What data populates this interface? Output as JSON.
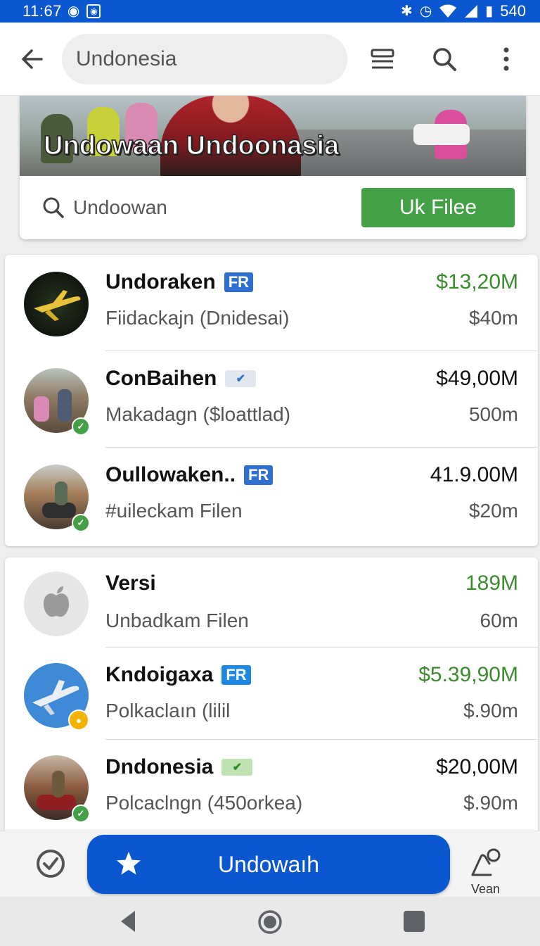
{
  "status_bar": {
    "time": "11:67",
    "battery": "540"
  },
  "toolbar": {
    "search_value": "Undonesia"
  },
  "hero": {
    "title": "Undowaan Undoonasia",
    "search_placeholder": "Undoowan",
    "button_label": "Uk Filee"
  },
  "list_a": [
    {
      "title": "Undoraken",
      "badge": "FR",
      "badge_type": "fr",
      "subtitle": "Fiidackajn (Dnidesai)",
      "amount": "$13,20M",
      "amount_color": "green",
      "size": "$40m",
      "avatar": "plane-dark"
    },
    {
      "title": "ConBaihen",
      "badge": "✔",
      "badge_type": "verify",
      "subtitle": "Makadagn ($loattlad)",
      "amount": "$49,00M",
      "amount_color": "default",
      "size": "500m",
      "avatar": "street"
    },
    {
      "title": "Oullowaken..",
      "badge": "FR",
      "badge_type": "fr",
      "subtitle": "#uileckam Filen",
      "amount": "41.9.00M",
      "amount_color": "default",
      "size": "$20m",
      "avatar": "motorbike"
    }
  ],
  "list_b": [
    {
      "title": "Versi",
      "badge": "",
      "badge_type": "none",
      "subtitle": "Unbadkam Filen",
      "amount": "189M",
      "amount_color": "green",
      "size": "60m",
      "avatar": "apple"
    },
    {
      "title": "Kndoigaxa",
      "badge": "FR",
      "badge_type": "fr",
      "subtitle": "Polkaclaın (lilil",
      "amount": "$5.39,90M",
      "amount_color": "green",
      "size": "$.90m",
      "avatar": "plane-blue"
    },
    {
      "title": "Dndonesia",
      "badge": "✔",
      "badge_type": "verify-green",
      "subtitle": "Polcaclngn (450orkea)",
      "amount": "$20,00M",
      "amount_color": "default",
      "size": "$.90m",
      "avatar": "motorbike"
    }
  ],
  "bottom_bar": {
    "main_button": "Undowaıh",
    "right_label": "Vean"
  },
  "colors": {
    "primary": "#0b57d0",
    "green_button": "#43a047",
    "green_amount": "#3a8c2e",
    "badge_blue": "#2f6fcf"
  },
  "icons": {
    "toolbar": [
      "back-arrow-icon",
      "list-view-icon",
      "search-icon",
      "more-vert-icon"
    ],
    "bottom": [
      "check-circle-icon",
      "star-icon",
      "user-location-icon"
    ],
    "nav": [
      "nav-back-icon",
      "nav-home-icon",
      "nav-recents-icon"
    ]
  }
}
